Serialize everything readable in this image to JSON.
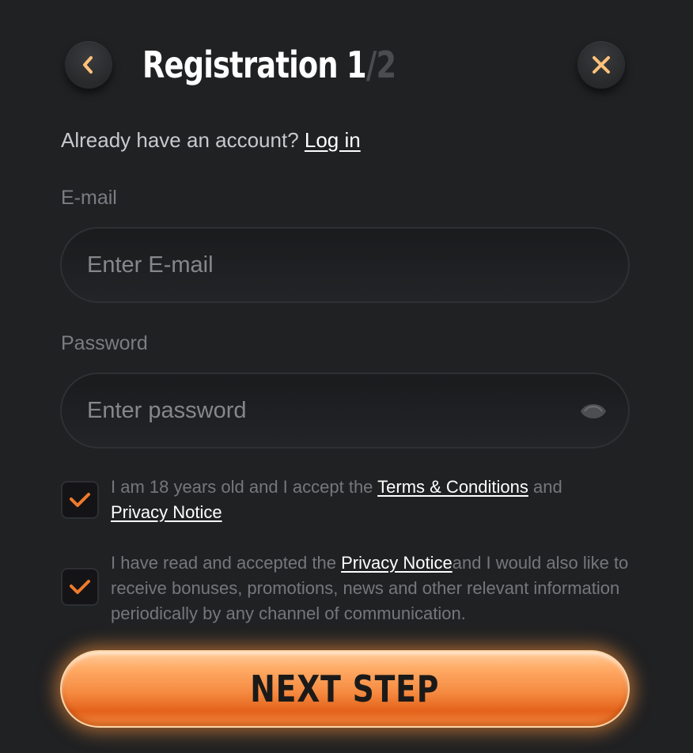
{
  "header": {
    "title": "Registration",
    "step_current": "1",
    "step_separator": "/",
    "step_total": "2",
    "back_icon": "chevron-left-icon",
    "close_icon": "close-icon"
  },
  "login_prompt": {
    "text": "Already have an account?",
    "link": "Log in"
  },
  "email": {
    "label": "E-mail",
    "placeholder": "Enter E-mail",
    "value": ""
  },
  "password": {
    "label": "Password",
    "placeholder": "Enter password",
    "value": "",
    "toggle_icon": "eye-icon"
  },
  "consents": [
    {
      "checked": true,
      "text_before": "I am 18 years old and I accept the",
      "link1": "Terms & Conditions",
      "text_mid": "and",
      "link2": "Privacy Notice"
    },
    {
      "checked": true,
      "text_before": "I have read and accepted the",
      "link": "Privacy Notice",
      "text_after": "and I would also like to receive bonuses, promotions, news and other relevant information periodically by any channel of communication."
    }
  ],
  "submit": {
    "label": "NEXT STEP"
  },
  "colors": {
    "background": "#202123",
    "accent": "#f58a40",
    "check": "#f07a2a",
    "icon": "#ffc27a"
  }
}
